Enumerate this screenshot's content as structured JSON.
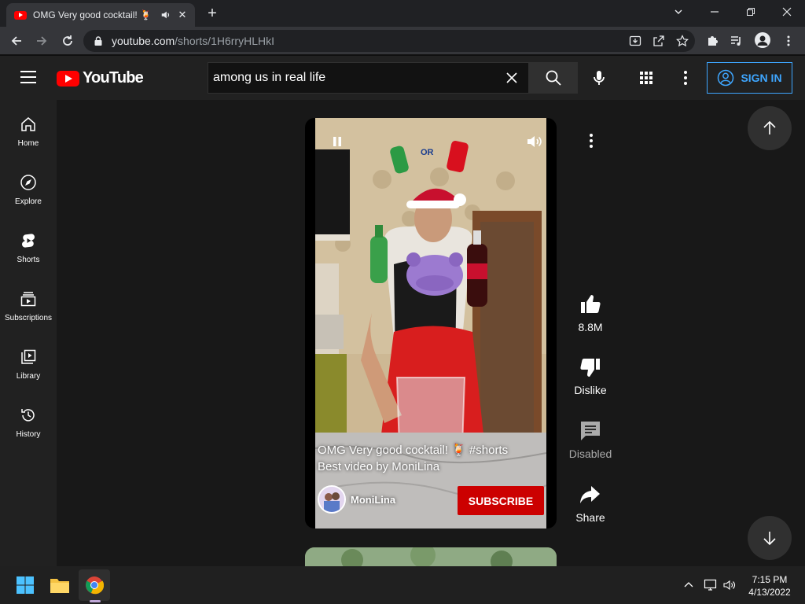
{
  "browser": {
    "tab_title": "OMG Very good cocktail! 🍹",
    "new_tab_label": "+",
    "url_host": "youtube.com",
    "url_path": "/shorts/1H6rryHLHkI"
  },
  "masthead": {
    "logo_text": "YouTube",
    "search_value": "among us in real life",
    "sign_in_label": "SIGN IN"
  },
  "guide": {
    "items": [
      {
        "label": "Home",
        "icon": "home-icon"
      },
      {
        "label": "Explore",
        "icon": "compass-icon"
      },
      {
        "label": "Shorts",
        "icon": "shorts-icon"
      },
      {
        "label": "Subscriptions",
        "icon": "subscriptions-icon"
      },
      {
        "label": "Library",
        "icon": "library-icon"
      },
      {
        "label": "History",
        "icon": "history-icon"
      }
    ]
  },
  "short": {
    "title_line1": "OMG Very good cocktail! 🍹 #shorts",
    "title_line2": "Best video by MoniLina",
    "channel": "MoniLina",
    "subscribe_label": "SUBSCRIBE",
    "overlay_text": "OR"
  },
  "actions": {
    "likes": "8.8M",
    "dislike_label": "Dislike",
    "comments_label": "Disabled",
    "share_label": "Share"
  },
  "taskbar": {
    "time": "7:15 PM",
    "date": "4/13/2022"
  },
  "colors": {
    "brand_red": "#ff0000",
    "subscribe_red": "#cc0000",
    "sign_in_blue": "#3ea6ff",
    "background": "#0f0f0f"
  }
}
